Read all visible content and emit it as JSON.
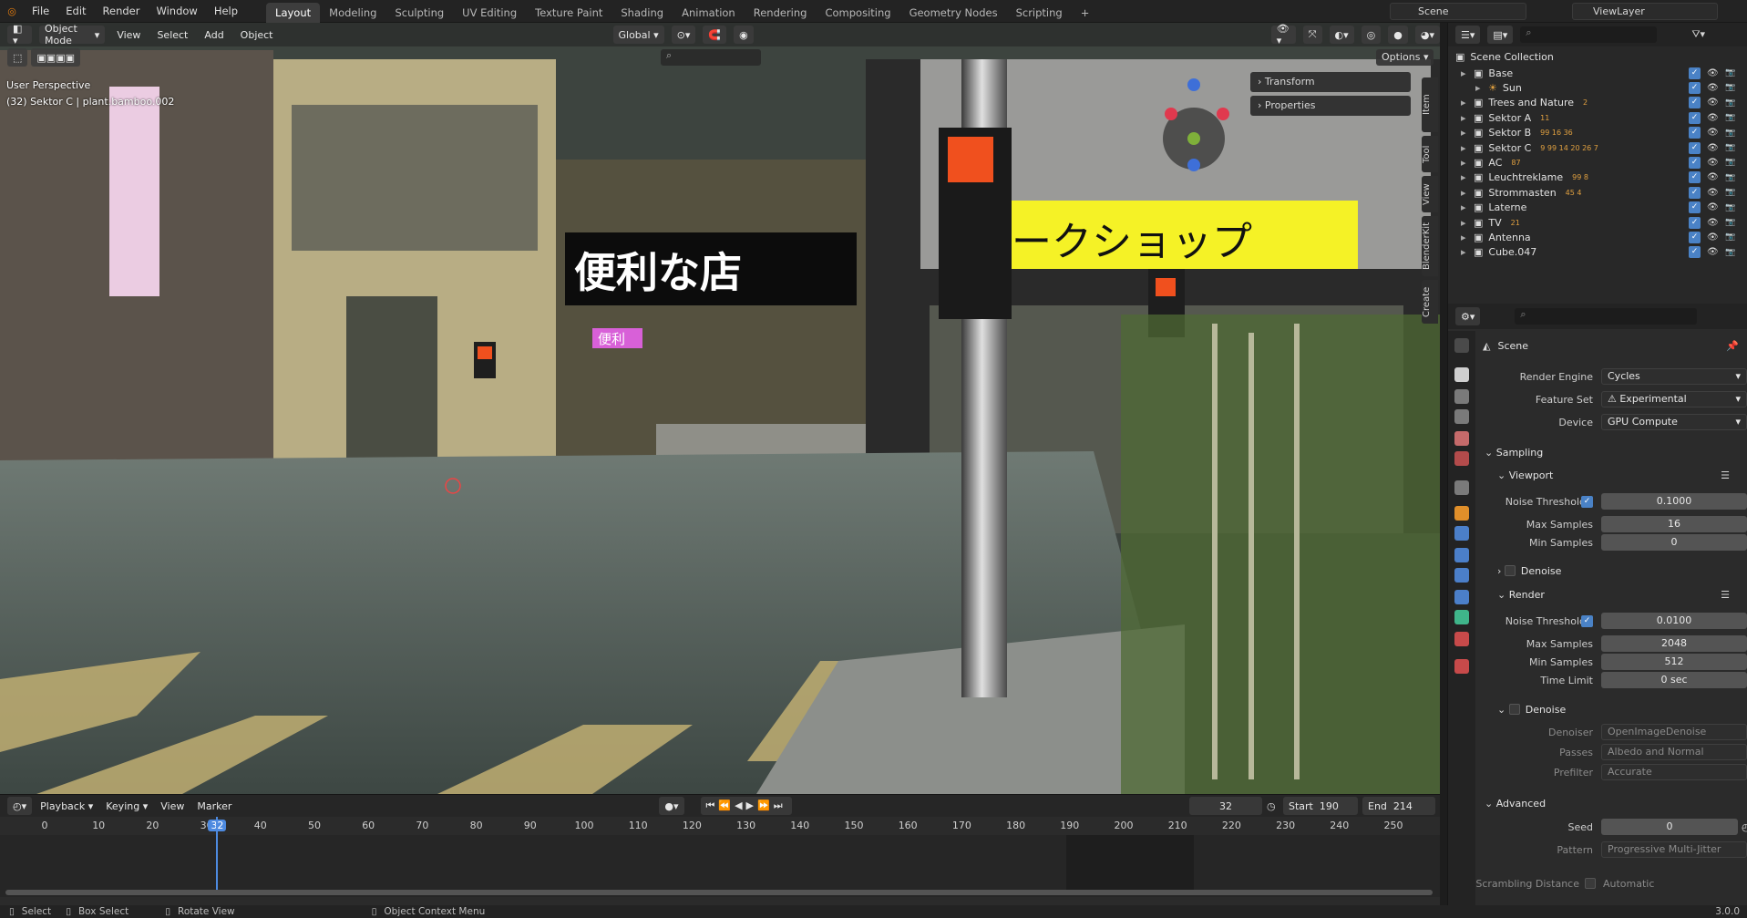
{
  "menu": [
    "File",
    "Edit",
    "Render",
    "Window",
    "Help"
  ],
  "workspaces": [
    "Layout",
    "Modeling",
    "Sculpting",
    "UV Editing",
    "Texture Paint",
    "Shading",
    "Animation",
    "Rendering",
    "Compositing",
    "Geometry Nodes",
    "Scripting"
  ],
  "active_workspace": "Layout",
  "scene_name": "Scene",
  "view_layer": "ViewLayer",
  "viewport": {
    "mode": "Object Mode",
    "menus": [
      "View",
      "Select",
      "Add",
      "Object"
    ],
    "orientation": "Global",
    "options_label": "Options",
    "overlay_info": [
      "User Perspective",
      "(32) Sektor C | plant.bamboo.002"
    ],
    "npanel": {
      "transform": "Transform",
      "properties": "Properties"
    },
    "side_tabs": [
      "Item",
      "Tool",
      "View",
      "BlenderKit",
      "Create"
    ],
    "scene_signs": {
      "kanji": "便利な店",
      "neon": "便利",
      "katakana": "ークショップ"
    }
  },
  "outliner": {
    "root": "Scene Collection",
    "items": [
      {
        "name": "Base",
        "depth": 0,
        "badges": ""
      },
      {
        "name": "Sun",
        "depth": 1,
        "badges": ""
      },
      {
        "name": "Trees and Nature",
        "depth": 0,
        "badges": "2"
      },
      {
        "name": "Sektor A",
        "depth": 0,
        "badges": "11"
      },
      {
        "name": "Sektor B",
        "depth": 0,
        "badges": "99 16 36"
      },
      {
        "name": "Sektor C",
        "depth": 0,
        "badges": "9 99 14 20 26 7"
      },
      {
        "name": "AC",
        "depth": 0,
        "badges": "87"
      },
      {
        "name": "Leuchtreklame",
        "depth": 0,
        "badges": "99 8"
      },
      {
        "name": "Strommasten",
        "depth": 0,
        "badges": "45 4"
      },
      {
        "name": "Laterne",
        "depth": 0,
        "badges": ""
      },
      {
        "name": "TV",
        "depth": 0,
        "badges": "21"
      },
      {
        "name": "Antenna",
        "depth": 0,
        "badges": ""
      },
      {
        "name": "Cube.047",
        "depth": 0,
        "badges": ""
      }
    ]
  },
  "properties": {
    "context": "Scene",
    "render_engine_label": "Render Engine",
    "render_engine": "Cycles",
    "feature_set_label": "Feature Set",
    "feature_set": "Experimental",
    "device_label": "Device",
    "device": "GPU Compute",
    "sampling": "Sampling",
    "viewport_label": "Viewport",
    "noise_threshold_label": "Noise Threshold",
    "vp_noise_threshold": "0.1000",
    "max_samples_label": "Max Samples",
    "vp_max_samples": "16",
    "min_samples_label": "Min Samples",
    "vp_min_samples": "0",
    "denoise_label": "Denoise",
    "render_label": "Render",
    "r_noise_threshold": "0.0100",
    "r_max_samples": "2048",
    "r_min_samples": "512",
    "time_limit_label": "Time Limit",
    "r_time_limit": "0 sec",
    "denoiser_label": "Denoiser",
    "denoiser": "OpenImageDenoise",
    "passes_label": "Passes",
    "passes": "Albedo and Normal",
    "prefilter_label": "Prefilter",
    "prefilter": "Accurate",
    "advanced_label": "Advanced",
    "seed_label": "Seed",
    "seed": "0",
    "pattern_label": "Pattern",
    "pattern": "Progressive Multi-Jitter",
    "scrambling_label": "Scrambling Distance",
    "scrambling": "Automatic"
  },
  "timeline": {
    "menus": [
      "Playback",
      "Keying",
      "View",
      "Marker"
    ],
    "current_frame": "32",
    "start_label": "Start",
    "start": "190",
    "end_label": "End",
    "end": "214",
    "ticks": [
      "0",
      "10",
      "20",
      "30",
      "40",
      "50",
      "60",
      "70",
      "80",
      "90",
      "100",
      "110",
      "120",
      "130",
      "140",
      "150",
      "160",
      "170",
      "180",
      "190",
      "200",
      "210",
      "220",
      "230",
      "240",
      "250"
    ]
  },
  "statusbar": {
    "select": "Select",
    "box_select": "Box Select",
    "rotate": "Rotate View",
    "context_menu": "Object Context Menu",
    "version": "3.0.0"
  }
}
